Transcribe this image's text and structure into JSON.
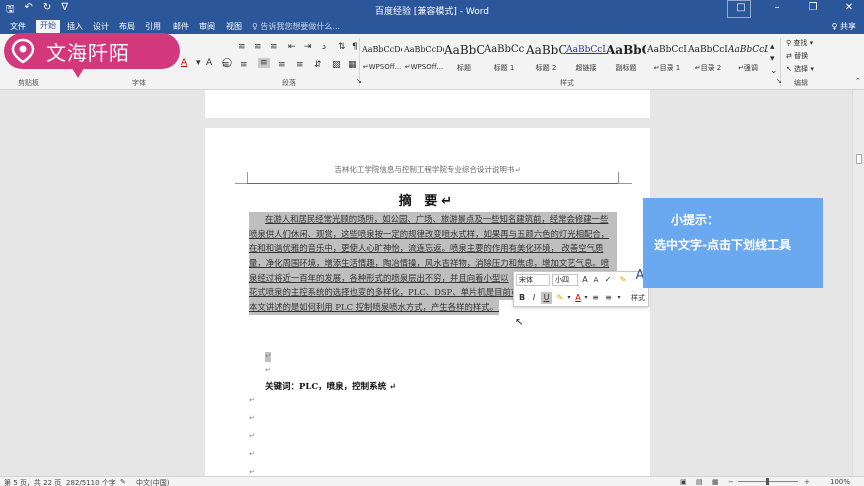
{
  "window": {
    "title": "百度经验 [兼容模式] - Word",
    "share": "♀ 共享"
  },
  "tabs": [
    {
      "label": "文件"
    },
    {
      "label": "开始"
    },
    {
      "label": "插入"
    },
    {
      "label": "设计"
    },
    {
      "label": "布局"
    },
    {
      "label": "引用"
    },
    {
      "label": "邮件"
    },
    {
      "label": "审阅"
    },
    {
      "label": "视图"
    }
  ],
  "tellme": "♀ 告诉我您想要做什么...",
  "logo_text": "文海阡陌",
  "ribbon": {
    "groups": {
      "clipboard": "剪贴板",
      "font": "字体",
      "paragraph": "段落",
      "styles": "样式",
      "editing": "编辑"
    },
    "styles": [
      {
        "sample": "AaBbCcDd",
        "label": "↵WPSOff..."
      },
      {
        "sample": "AaBbCcDd",
        "label": "↵WPSOff..."
      },
      {
        "sample": "AaBbC",
        "label": "标题"
      },
      {
        "sample": "AaBbCc",
        "label": "标题 1"
      },
      {
        "sample": "AaBbC",
        "label": "标题 2"
      },
      {
        "sample": "AaBbCcI",
        "label": "超链接"
      },
      {
        "sample": "AaBbC",
        "label": "副标题"
      },
      {
        "sample": "AaBbCcI",
        "label": "↵目录 1"
      },
      {
        "sample": "AaBbCcI",
        "label": "↵目录 2"
      },
      {
        "sample": "AaBbCcL",
        "label": "↵强调"
      }
    ],
    "editing": {
      "find": "查找 ▾",
      "replace": "替换",
      "select": "选择 ▾"
    }
  },
  "document": {
    "header_text": "吉林化工学院信息与控制工程学院专业综合设计说明书↵",
    "abstract_title": "摘  要↵",
    "abstract_lines": [
      "在游人和居民经常光顾的场所，如公园、广场、旅游景点及一些知名建筑前，经常会修建一些",
      "喷泉供人们休闲、观赏，这些喷泉按一定的规律改变喷水式样，如果再与五颜六色的灯光相配合，",
      "在和和谐优雅的音乐中，更使人心旷神怡，流连忘返。喷泉主要的作用有美化环境，  改善空气质",
      "量，净化周围环境，增添生活情趣，陶冶情操，风水吉祥物，消除压力和焦虑，增加文艺气息。喷",
      "泉经过将近一百年的发展，各种形式的喷泉层出不穷，并且向着小型以",
      "花式喷泉的主控系统的选择也变的多样化，PLC、DSP、单片机是目前市",
      "本文讲述的是如何利用 PLC 控制喷泉喷水方式，产生各样的样式。  ↵"
    ],
    "keywords": "关键词：PLC，喷泉，控制系统  ↵",
    "paragraph_mark": "↵"
  },
  "mini_toolbar": {
    "font": "宋体",
    "size": "小四",
    "styles_label": "样式"
  },
  "tip": {
    "title": "小提示：",
    "body": "选中文字-点击下划线工具"
  },
  "status": {
    "page": "第 5 页，共 22 页",
    "words": "282/5110 个字",
    "language": "中文(中国)",
    "zoom": "100%"
  }
}
